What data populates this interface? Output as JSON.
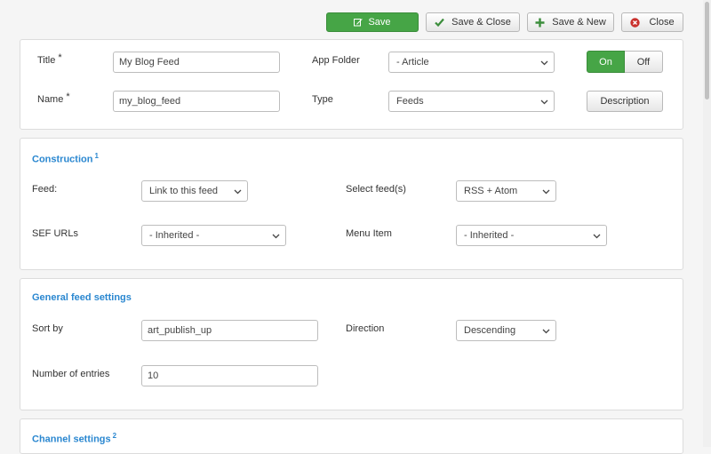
{
  "toolbar": {
    "save": "Save",
    "save_close": "Save & Close",
    "save_new": "Save & New",
    "close": "Close"
  },
  "header_panel": {
    "title_label": "Title",
    "title_value": "My Blog Feed",
    "name_label": "Name",
    "name_value": "my_blog_feed",
    "required_mark": "*",
    "app_folder_label": "App Folder",
    "app_folder_value": "- Article",
    "type_label": "Type",
    "type_value": "Feeds",
    "toggle_on": "On",
    "toggle_off": "Off",
    "description_button": "Description"
  },
  "construction": {
    "title": "Construction",
    "footnote": "1",
    "feed_label": "Feed:",
    "feed_value": "Link to this feed",
    "select_feeds_label": "Select feed(s)",
    "select_feeds_value": "RSS + Atom",
    "sef_label": "SEF URLs",
    "sef_value": "- Inherited -",
    "menu_item_label": "Menu Item",
    "menu_item_value": "- Inherited -"
  },
  "general": {
    "title": "General feed settings",
    "sort_label": "Sort by",
    "sort_value": "art_publish_up",
    "direction_label": "Direction",
    "direction_value": "Descending",
    "entries_label": "Number of entries",
    "entries_value": "10"
  },
  "channel": {
    "title": "Channel settings",
    "footnote": "2"
  },
  "colors": {
    "accent_green": "#46a546",
    "section_blue": "#2a87d0",
    "close_red": "#c9302c"
  },
  "icons": [
    "edit-icon",
    "check-icon",
    "plus-icon",
    "close-circle-icon",
    "chevron-down-icon"
  ]
}
